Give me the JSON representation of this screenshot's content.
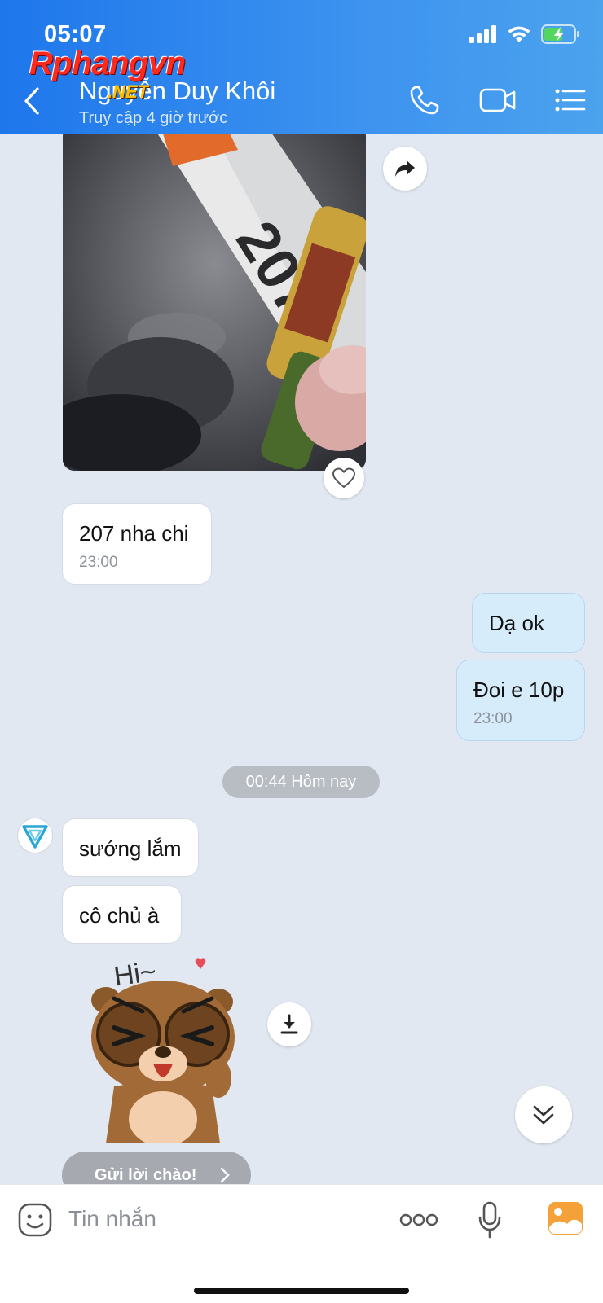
{
  "status_bar": {
    "time": "05:07"
  },
  "watermark": {
    "brand": "Rphangvn",
    "suffix": ".NET"
  },
  "header": {
    "contact_name": "Nguyễn Duy Khôi",
    "contact_status": "Truy cập 4 giờ trước",
    "icons": [
      "back-icon",
      "phone-icon",
      "video-call-icon",
      "menu-list-icon"
    ]
  },
  "messages": {
    "photo_label": "207",
    "msg1": {
      "text": "207 nha chi",
      "time": "23:00"
    },
    "msg2": {
      "text": "Dạ ok"
    },
    "msg3": {
      "text": "Đoi e 10p",
      "time": "23:00"
    },
    "date_separator": "00:44 Hôm nay",
    "msg4": {
      "text": "sướng lắm"
    },
    "msg5": {
      "text": "cô chủ à"
    },
    "sticker_text": "Hi~"
  },
  "greet_button": {
    "label": "Gửi lời chào!"
  },
  "input": {
    "placeholder": "Tin nhắn"
  },
  "colors": {
    "header": "#2a85ee",
    "outgoing_bubble": "#d7ecfb",
    "chat_bg": "#e2e8f1"
  }
}
